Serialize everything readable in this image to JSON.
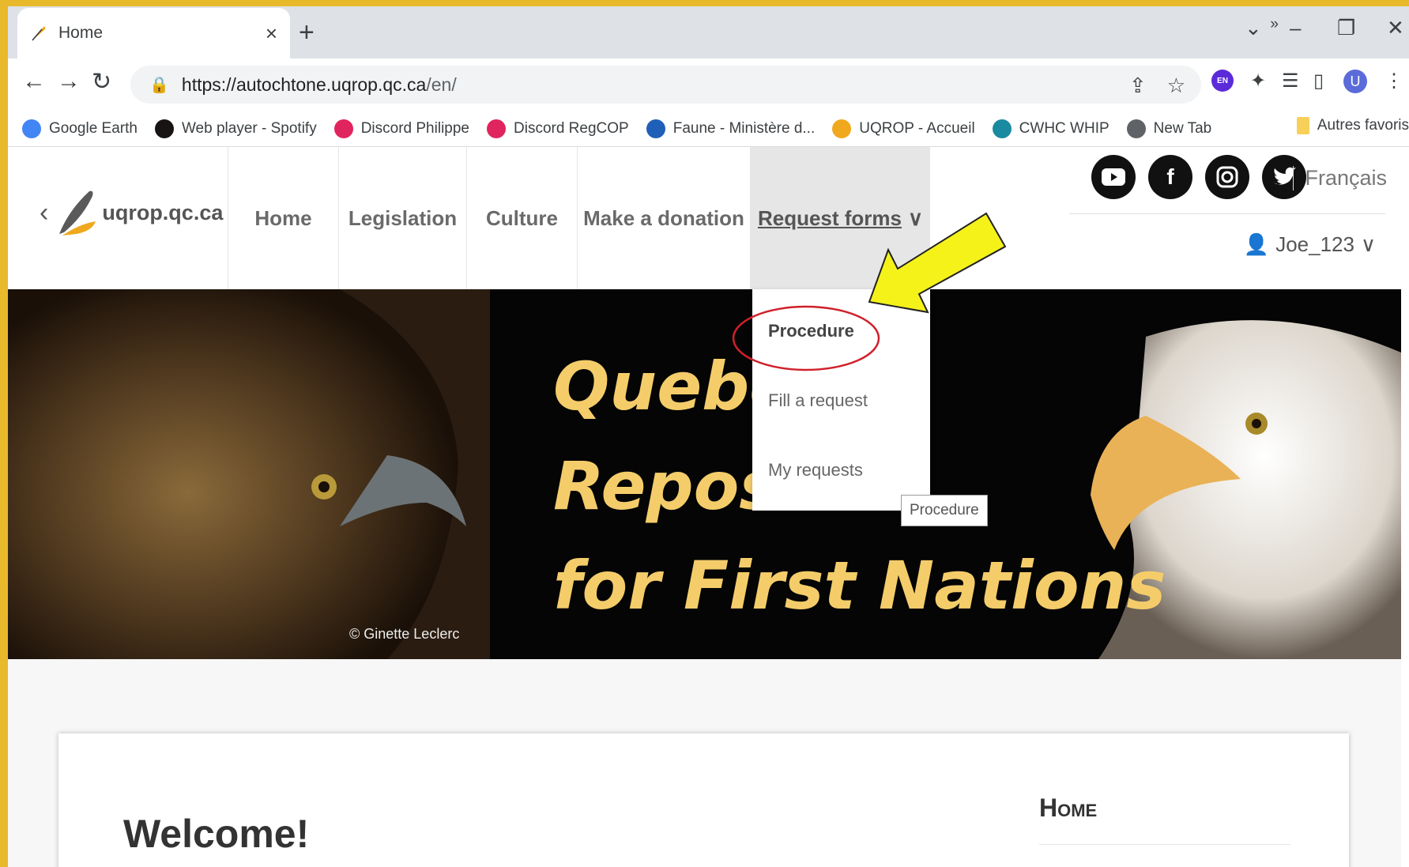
{
  "browser": {
    "tab_title": "Home",
    "tab_close": "×",
    "new_tab": "+",
    "url_host": "https://autochtone.uqrop.qc.ca",
    "url_path": "/en/",
    "profile_initial": "U",
    "ext_badge": "EN"
  },
  "bookmarks": [
    {
      "label": "Google Earth",
      "color": "#4285f4"
    },
    {
      "label": "Web player - Spotify",
      "color": "#191414"
    },
    {
      "label": "Discord Philippe",
      "color": "#e0245e"
    },
    {
      "label": "Discord RegCOP",
      "color": "#e0245e"
    },
    {
      "label": "Faune - Ministère d...",
      "color": "#1f5fb7"
    },
    {
      "label": "UQROP - Accueil",
      "color": "#f0a81e"
    },
    {
      "label": "CWHC WHIP",
      "color": "#1a8aa0"
    },
    {
      "label": "New Tab",
      "color": "#5f6368"
    }
  ],
  "bookmarks_more": "»",
  "bookmarks_other": "Autres favoris",
  "site": {
    "logo_text": "uqrop.qc.ca",
    "nav": [
      "Home",
      "Legislation",
      "Culture",
      "Make a donation",
      "Request forms"
    ],
    "language": "Français",
    "user": "Joe_123",
    "dropdown": [
      "Procedure",
      "Fill a request",
      "My requests"
    ],
    "tooltip": "Procedure",
    "banner_lines": [
      "Quebec",
      "Reposit",
      "for First Nations"
    ],
    "credit": "© Ginette Leclerc",
    "welcome": "Welcome!",
    "side_heading": "Home"
  },
  "colors": {
    "frame": "#e9b92c",
    "banner_text": "#f4cd6a",
    "annotation_arrow": "#f5f21a",
    "annotation_circle": "#d0202a"
  }
}
